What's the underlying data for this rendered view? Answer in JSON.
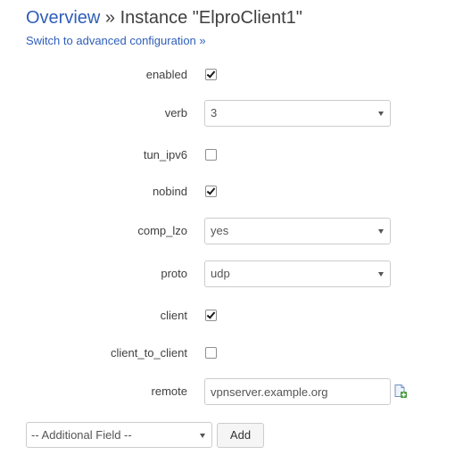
{
  "header": {
    "breadcrumb_link": "Overview",
    "breadcrumb_rest": " » Instance \"ElproClient1\"",
    "advanced_link": "Switch to advanced configuration »"
  },
  "fields": {
    "enabled": {
      "label": "enabled",
      "checked": true
    },
    "verb": {
      "label": "verb",
      "value": "3"
    },
    "tun_ipv6": {
      "label": "tun_ipv6",
      "checked": false
    },
    "nobind": {
      "label": "nobind",
      "checked": true
    },
    "comp_lzo": {
      "label": "comp_lzo",
      "value": "yes"
    },
    "proto": {
      "label": "proto",
      "value": "udp"
    },
    "client": {
      "label": "client",
      "checked": true
    },
    "client_to_client": {
      "label": "client_to_client",
      "checked": false
    },
    "remote": {
      "label": "remote",
      "value": "vpnserver.example.org",
      "icon": "add-entry-icon"
    }
  },
  "footer": {
    "additional_field_select": "-- Additional Field --",
    "add_button": "Add"
  },
  "colors": {
    "link": "#2f5eb9",
    "text": "#404040",
    "border": "#cccccc"
  }
}
